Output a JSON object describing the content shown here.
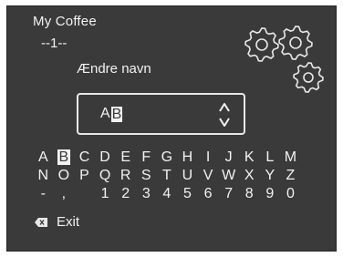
{
  "header": {
    "title": "My Coffee",
    "entry_index": "--1--",
    "prompt": "Ændre navn",
    "settings_icon": "gears-icon"
  },
  "name_field": {
    "value_prefix": "A",
    "cursor_char": "B",
    "scroll_icon": "up-down-arrows-icon"
  },
  "keyboard": {
    "selected_key": "B",
    "row1": [
      "A",
      "B",
      "C",
      "D",
      "E",
      "F",
      "G",
      "H",
      "I",
      "J",
      "K",
      "L",
      "M"
    ],
    "row2": [
      "N",
      "O",
      "P",
      "Q",
      "R",
      "S",
      "T",
      "U",
      "V",
      "W",
      "X",
      "Y",
      "Z"
    ],
    "row3": [
      "-",
      ",",
      "",
      "1",
      "2",
      "3",
      "4",
      "5",
      "6",
      "7",
      "8",
      "9",
      "0"
    ]
  },
  "exit": {
    "icon": "backspace-icon",
    "label": "Exit"
  }
}
